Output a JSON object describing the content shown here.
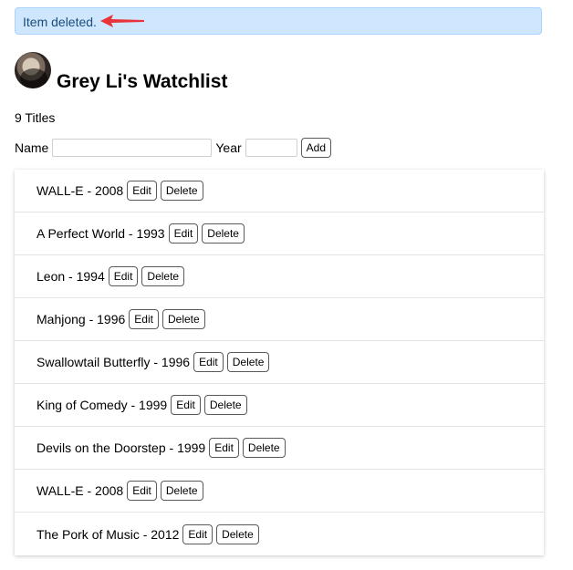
{
  "flash": {
    "message": "Item deleted.",
    "colors": {
      "background": "#cfe6ff",
      "border": "#a9d2ff",
      "text": "#1b4d7a",
      "arrow": "#e8333a"
    }
  },
  "header": {
    "avatar": "avatar-photo",
    "title": "Grey Li's Watchlist"
  },
  "count_text": "9 Titles",
  "form": {
    "name_label": "Name",
    "name_value": "",
    "year_label": "Year",
    "year_value": "",
    "add_label": "Add"
  },
  "movies": [
    {
      "text": "WALL-E - 2008",
      "edit": "Edit",
      "delete": "Delete"
    },
    {
      "text": "A Perfect World - 1993",
      "edit": "Edit",
      "delete": "Delete"
    },
    {
      "text": "Leon - 1994",
      "edit": "Edit",
      "delete": "Delete"
    },
    {
      "text": "Mahjong - 1996",
      "edit": "Edit",
      "delete": "Delete"
    },
    {
      "text": "Swallowtail Butterfly - 1996",
      "edit": "Edit",
      "delete": "Delete"
    },
    {
      "text": "King of Comedy - 1999",
      "edit": "Edit",
      "delete": "Delete"
    },
    {
      "text": "Devils on the Doorstep - 1999",
      "edit": "Edit",
      "delete": "Delete"
    },
    {
      "text": "WALL-E - 2008",
      "edit": "Edit",
      "delete": "Delete"
    },
    {
      "text": "The Pork of Music - 2012",
      "edit": "Edit",
      "delete": "Delete"
    }
  ]
}
